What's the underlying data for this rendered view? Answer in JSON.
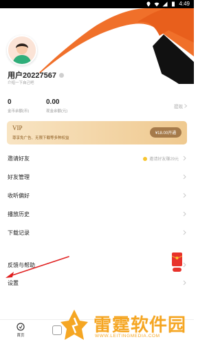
{
  "status_bar": {
    "time": "4:49"
  },
  "profile": {
    "username": "用户20227567",
    "intro": "介绍一下自己吧"
  },
  "stats": {
    "coins": {
      "value": "0",
      "label": "金币余额(币)"
    },
    "cash": {
      "value": "0.00",
      "label": "现金余额(元)"
    },
    "withdraw_label": "提现"
  },
  "vip": {
    "title": "VIP",
    "description": "尊享免广告、无限下载等多种权益",
    "button_label": "¥18.00开通"
  },
  "menu": {
    "items": [
      {
        "label": "邀请好友",
        "extra": "邀请好友赚29元"
      },
      {
        "label": "好友管理"
      },
      {
        "label": "收听偏好"
      },
      {
        "label": "播放历史"
      },
      {
        "label": "下载记录"
      },
      {
        "label": "反馈与帮助"
      },
      {
        "label": "设置"
      }
    ]
  },
  "tabbar": {
    "home_label": "首页"
  },
  "watermark": {
    "title": "雷霆软件园",
    "url": "WWW.LEITINGMEDIA.COM"
  },
  "colors": {
    "accent_orange": "#f0702a",
    "vip_gold": "#efc98f",
    "annotation_red": "#e02020",
    "watermark_orange": "#f5a623"
  }
}
